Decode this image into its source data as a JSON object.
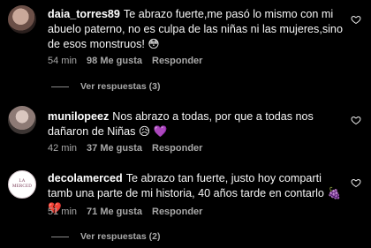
{
  "comments": [
    {
      "username": "daia_torres89",
      "text": "Te abrazo fuerte,me pasó lo mismo con mi abuelo paterno, no es culpa de las niñas ni las mujeres,sino de esos monstruos!",
      "emoji_after": "😳",
      "time": "54 min",
      "likes": "98 Me gusta",
      "reply_label": "Responder",
      "view_replies": "Ver respuestas (3)"
    },
    {
      "username": "munilopeez",
      "text": "Nos abrazo a todas, por que a todas nos dañaron de Niñas",
      "emoji_after": "😥 💜",
      "time": "42 min",
      "likes": "37 Me gusta",
      "reply_label": "Responder"
    },
    {
      "username": "decolamerced",
      "avatar_text": "LA MERCED",
      "text": "Te abrazo tan fuerte, justo hoy comparti tamb una parte de mi historia, 40 años tarde en contarlo",
      "emoji_after": "🍇 💔",
      "time": "51 min",
      "likes": "71 Me gusta",
      "reply_label": "Responder",
      "view_replies": "Ver respuestas (2)"
    }
  ],
  "colors": {
    "background": "#000000",
    "text": "#f5f5f5",
    "muted": "#a8a8a8"
  },
  "icons": {
    "like": "heart-outline-icon"
  }
}
